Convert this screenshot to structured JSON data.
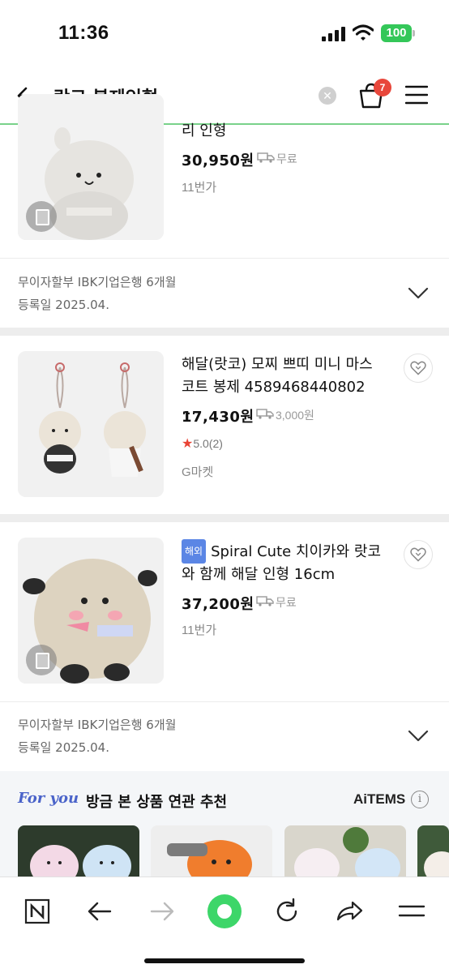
{
  "status": {
    "time": "11:36",
    "battery": "100"
  },
  "search": {
    "query": "랏코 봉제인형",
    "cart_count": "7"
  },
  "products": [
    {
      "title": "리 인형",
      "price": "30,950원",
      "shipping": "무료",
      "seller": "11번가",
      "installment": "무이자할부 IBK기업은행 6개월",
      "registered": "등록일 2025.04."
    },
    {
      "title": "해달(랏코) 모찌 쁘띠 미니 마스코트 봉제 4589468440802 …",
      "price": "17,430원",
      "shipping": "3,000원",
      "rating": "5.0(2)",
      "seller": "G마켓"
    },
    {
      "tag": "해외",
      "title": "Spiral Cute 치이카와 랏코와 함께 해달 인형 16cm",
      "price": "37,200원",
      "shipping": "무료",
      "seller": "11번가",
      "installment": "무이자할부 IBK기업은행 6개월",
      "registered": "등록일 2025.04."
    }
  ],
  "foryou": {
    "brand": "For you",
    "title": "방금 본 상품 연관 추천",
    "provider": "AiTEMS",
    "info_icon": "i"
  },
  "colors": {
    "accent_green": "#79d28a",
    "badge_red": "#e8473b",
    "tag_blue": "#5b86e5",
    "home_green": "#34c759"
  },
  "icons": [
    "back-arrow-icon",
    "clear-icon",
    "cart-icon",
    "menu-icon",
    "copy-icon",
    "heart-icon",
    "chevron-down-icon",
    "n-logo-icon",
    "nav-back-icon",
    "nav-forward-icon",
    "home-icon",
    "refresh-icon",
    "share-icon",
    "hamburger-icon"
  ]
}
